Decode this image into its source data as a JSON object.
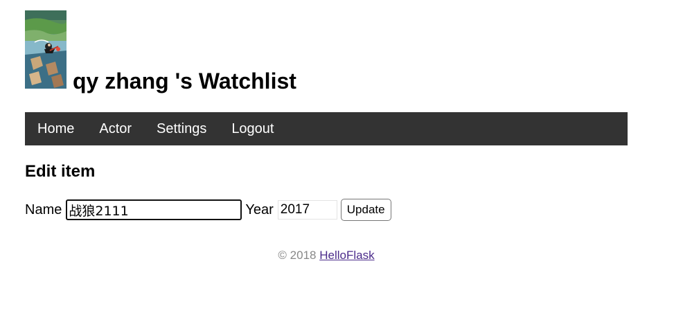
{
  "header": {
    "title": "qy zhang 's Watchlist",
    "avatar_icon": "avatar-illustration"
  },
  "nav": {
    "items": [
      {
        "label": "Home"
      },
      {
        "label": "Actor"
      },
      {
        "label": "Settings"
      },
      {
        "label": "Logout"
      }
    ],
    "background": "#333333"
  },
  "edit": {
    "title": "Edit item",
    "name_label": "Name",
    "name_value": "战狼2111",
    "year_label": "Year",
    "year_value": "2017",
    "submit_label": "Update"
  },
  "footer": {
    "copyright": "© 2018",
    "link_text": "HelloFlask"
  }
}
